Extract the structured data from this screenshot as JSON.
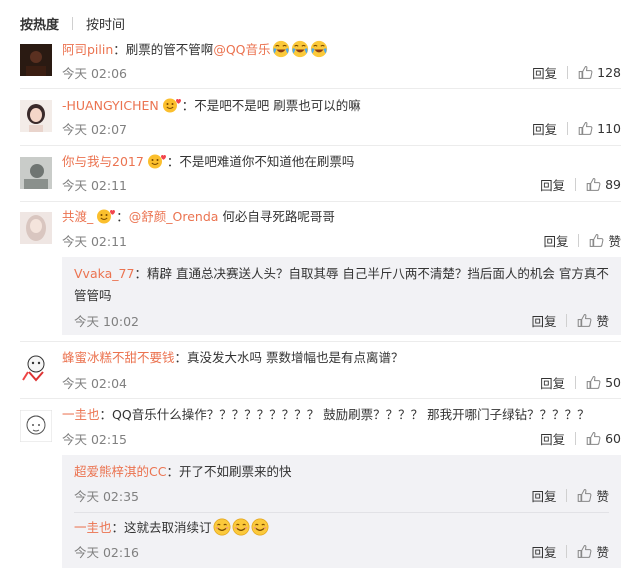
{
  "sort": {
    "hot": "按热度",
    "time": "按时间"
  },
  "icons": {
    "like": "thumbs-up-icon",
    "badge": "heart-badge-icon",
    "emoji": "emoji-icon"
  },
  "colors": {
    "username": "#eb7350",
    "time": "#808080",
    "reply_bg": "#f2f2f5"
  },
  "comments": [
    {
      "user": "阿司pilin",
      "sep": "：",
      "text": "刷票的管不管啊",
      "mention": "@QQ音乐",
      "emoji_count": 3,
      "emoji_type": "crying-laugh",
      "time": "今天 02:06",
      "reply": "回复",
      "likes": "128"
    },
    {
      "user": "-HUANGYICHEN",
      "sep": "：",
      "text": "不是吧不是吧 刷票也可以的嘛",
      "has_badge": true,
      "time": "今天 02:07",
      "reply": "回复",
      "likes": "110"
    },
    {
      "user": "你与我与2017",
      "sep": "：",
      "text": "不是吧难道你不知道他在刷票吗",
      "has_badge": true,
      "time": "今天 02:11",
      "reply": "回复",
      "likes": "89"
    },
    {
      "user": "共渡_",
      "sep": "：",
      "mention": "@舒颜_Orenda",
      "text_after": " 何必自寻死路呢哥哥",
      "has_badge": true,
      "time": "今天 02:11",
      "reply": "回复",
      "likes": "赞",
      "replies": [
        {
          "user": "Vvaka_77",
          "sep": "：",
          "text": "精辟 直通总决赛送人头？自取其辱 自己半斤八两不清楚？挡后面人的机会 官方真不管管吗",
          "time": "今天 10:02",
          "reply": "回复",
          "likes": "赞"
        }
      ]
    },
    {
      "user": "蜂蜜冰糕不甜不要钱",
      "sep": "：",
      "text": "真没发大水吗 票数增幅也是有点离谱？",
      "time": "今天 02:04",
      "reply": "回复",
      "likes": "50"
    },
    {
      "user": "一圭也",
      "sep": "：",
      "text": "QQ音乐什么操作？？？？？？？？？ 鼓励刷票？？？？ 那我开哪门子绿钻？？？？？",
      "time": "今天 02:15",
      "reply": "回复",
      "likes": "60",
      "replies": [
        {
          "user": "超爱熊梓淇的CC",
          "sep": "：",
          "text": "开了不如刷票来的快",
          "time": "今天 02:35",
          "reply": "回复",
          "likes": "赞"
        },
        {
          "user": "一圭也",
          "sep": "：",
          "text": "这就去取消续订",
          "emoji_count": 3,
          "emoji_type": "smile",
          "time": "今天 02:16",
          "reply": "回复",
          "likes": "赞"
        }
      ]
    }
  ]
}
